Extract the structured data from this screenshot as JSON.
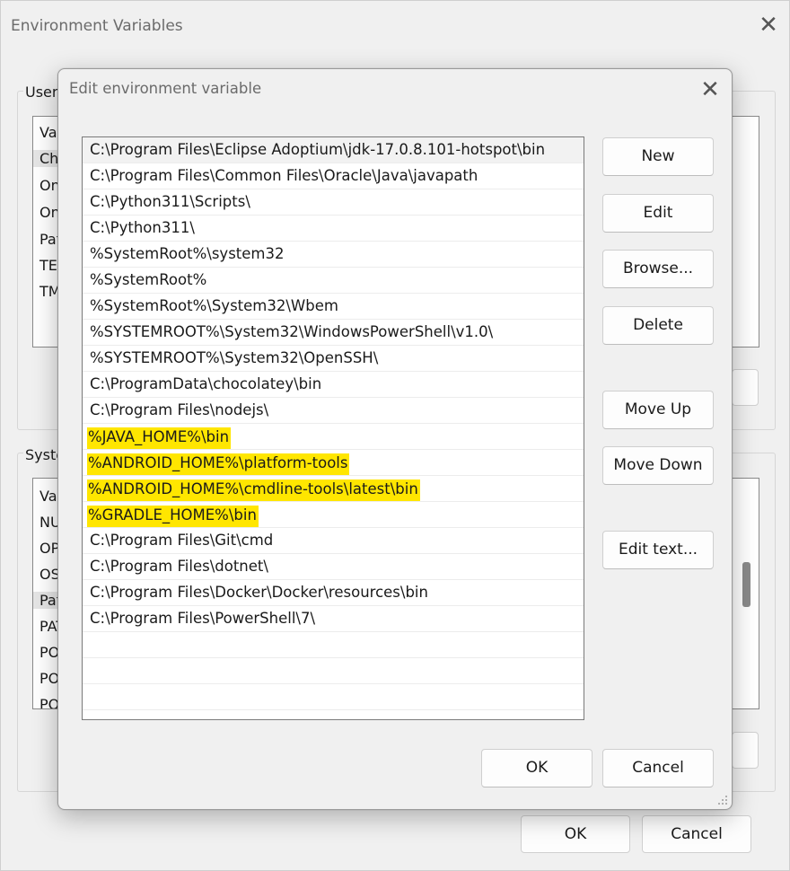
{
  "background_window": {
    "title": "Environment Variables",
    "close_glyph": "✕",
    "user_group_label": "User",
    "user_list_rows": [
      "Var",
      "Ch",
      "On",
      "On",
      "Pat",
      "TEI",
      "TM"
    ],
    "system_group_label": "Syste",
    "system_list_rows": [
      "Var",
      "NU",
      "OP",
      "OS",
      "Pat",
      "PAT",
      "PO",
      "PO",
      "PO"
    ],
    "ok_label": "OK",
    "cancel_label": "Cancel"
  },
  "dialog": {
    "title": "Edit environment variable",
    "close_glyph": "✕",
    "entries": [
      {
        "text": "C:\\Program Files\\Eclipse Adoptium\\jdk-17.0.8.101-hotspot\\bin",
        "highlighted": false
      },
      {
        "text": "C:\\Program Files\\Common Files\\Oracle\\Java\\javapath",
        "highlighted": false
      },
      {
        "text": "C:\\Python311\\Scripts\\",
        "highlighted": false
      },
      {
        "text": "C:\\Python311\\",
        "highlighted": false
      },
      {
        "text": "%SystemRoot%\\system32",
        "highlighted": false
      },
      {
        "text": "%SystemRoot%",
        "highlighted": false
      },
      {
        "text": "%SystemRoot%\\System32\\Wbem",
        "highlighted": false
      },
      {
        "text": "%SYSTEMROOT%\\System32\\WindowsPowerShell\\v1.0\\",
        "highlighted": false
      },
      {
        "text": "%SYSTEMROOT%\\System32\\OpenSSH\\",
        "highlighted": false
      },
      {
        "text": "C:\\ProgramData\\chocolatey\\bin",
        "highlighted": false
      },
      {
        "text": "C:\\Program Files\\nodejs\\",
        "highlighted": false
      },
      {
        "text": "%JAVA_HOME%\\bin",
        "highlighted": true
      },
      {
        "text": "%ANDROID_HOME%\\platform-tools",
        "highlighted": true
      },
      {
        "text": "%ANDROID_HOME%\\cmdline-tools\\latest\\bin",
        "highlighted": true
      },
      {
        "text": "%GRADLE_HOME%\\bin",
        "highlighted": true
      },
      {
        "text": "C:\\Program Files\\Git\\cmd",
        "highlighted": false
      },
      {
        "text": "C:\\Program Files\\dotnet\\",
        "highlighted": false
      },
      {
        "text": "C:\\Program Files\\Docker\\Docker\\resources\\bin",
        "highlighted": false
      },
      {
        "text": "C:\\Program Files\\PowerShell\\7\\",
        "highlighted": false
      },
      {
        "text": "",
        "highlighted": false
      },
      {
        "text": "",
        "highlighted": false
      },
      {
        "text": "",
        "highlighted": false
      }
    ],
    "buttons": {
      "new": "New",
      "edit": "Edit",
      "browse": "Browse...",
      "delete": "Delete",
      "move_up": "Move Up",
      "move_down": "Move Down",
      "edit_text": "Edit text..."
    },
    "ok_label": "OK",
    "cancel_label": "Cancel",
    "highlight_color": "#ffe600"
  }
}
